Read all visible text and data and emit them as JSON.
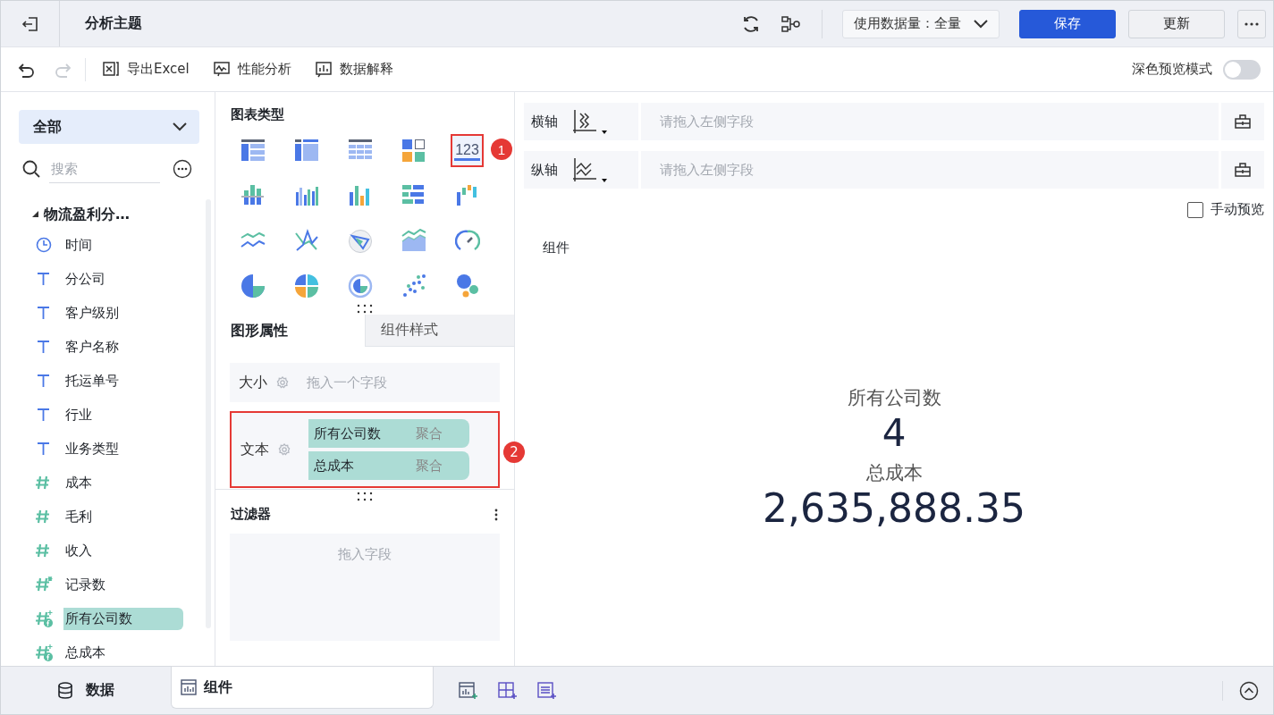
{
  "header": {
    "title": "分析主题",
    "data_volume": "使用数据量：全量",
    "buttons": [
      {
        "label": "保存",
        "kind": "primary"
      },
      {
        "label": "更新",
        "kind": "default"
      }
    ]
  },
  "toolbar": {
    "items": [
      {
        "label": "导出Excel",
        "kind": "excel"
      },
      {
        "label": "性能分析",
        "kind": "performance"
      },
      {
        "label": "数据解释",
        "kind": "explain"
      }
    ],
    "dark_preview": {
      "label": "深色预览模式",
      "on": false
    }
  },
  "data_panel": {
    "filter": "全部",
    "search": {
      "placeholder": "搜索"
    },
    "table": {
      "name": "物流盈利分…",
      "expanded": true,
      "fields": [
        {
          "name": "时间",
          "kind": "time",
          "selected": false
        },
        {
          "name": "分公司",
          "kind": "text",
          "selected": false
        },
        {
          "name": "客户级别",
          "kind": "text",
          "selected": false
        },
        {
          "name": "客户名称",
          "kind": "text",
          "selected": false
        },
        {
          "name": "托运单号",
          "kind": "text",
          "selected": false
        },
        {
          "name": "行业",
          "kind": "text",
          "selected": false
        },
        {
          "name": "业务类型",
          "kind": "text",
          "selected": false
        },
        {
          "name": "成本",
          "kind": "number",
          "selected": false
        },
        {
          "name": "毛利",
          "kind": "number",
          "selected": false
        },
        {
          "name": "收入",
          "kind": "number",
          "selected": false
        },
        {
          "name": "记录数",
          "kind": "count",
          "selected": false
        },
        {
          "name": "所有公司数",
          "kind": "calc",
          "selected": true
        },
        {
          "name": "总成本",
          "kind": "calc",
          "selected": false
        }
      ]
    }
  },
  "chart_types": {
    "title": "图表类型",
    "items": [
      {
        "kind": "table",
        "selected": false
      },
      {
        "kind": "crosstab",
        "selected": false
      },
      {
        "kind": "detail",
        "selected": false
      },
      {
        "kind": "blocks",
        "selected": false
      },
      {
        "kind": "kpi",
        "label": "123",
        "selected": true,
        "callout": "1"
      },
      {
        "kind": "stacked-bar",
        "selected": false
      },
      {
        "kind": "grouped-bar",
        "selected": false
      },
      {
        "kind": "bar",
        "selected": false
      },
      {
        "kind": "hbar",
        "selected": false
      },
      {
        "kind": "waterfall",
        "selected": false
      },
      {
        "kind": "line",
        "selected": false
      },
      {
        "kind": "cross-line",
        "selected": false
      },
      {
        "kind": "radar",
        "selected": false
      },
      {
        "kind": "area",
        "selected": false
      },
      {
        "kind": "gauge",
        "selected": false
      },
      {
        "kind": "pie",
        "selected": false
      },
      {
        "kind": "multi-pie",
        "selected": false
      },
      {
        "kind": "ring",
        "selected": false
      },
      {
        "kind": "scatter",
        "selected": false
      },
      {
        "kind": "bubble",
        "selected": false
      }
    ]
  },
  "property_tabs": [
    {
      "label": "图形属性",
      "selected": true
    },
    {
      "label": "组件样式",
      "selected": false
    }
  ],
  "wells": [
    {
      "label": "大小",
      "placeholder": "拖入一个字段"
    },
    {
      "label": "文本",
      "callout": "2",
      "fields": [
        {
          "name": "所有公司数",
          "agg": "聚合"
        },
        {
          "name": "总成本",
          "agg": "聚合"
        }
      ]
    }
  ],
  "filter": {
    "title": "过滤器",
    "placeholder": "拖入字段"
  },
  "axes": [
    {
      "label": "横轴",
      "placeholder": "请拖入左侧字段",
      "kind": "x"
    },
    {
      "label": "纵轴",
      "placeholder": "请拖入左侧字段",
      "kind": "y"
    }
  ],
  "manual_preview": {
    "label": "手动预览",
    "checked": false
  },
  "component": {
    "title": "组件",
    "metrics": [
      {
        "label": "所有公司数",
        "value": "4"
      },
      {
        "label": "总成本",
        "value": "2,635,888.35"
      }
    ]
  },
  "bottom_tabs": [
    {
      "label": "数据",
      "kind": "data",
      "selected": false
    },
    {
      "label": "组件",
      "kind": "component",
      "selected": true
    }
  ]
}
